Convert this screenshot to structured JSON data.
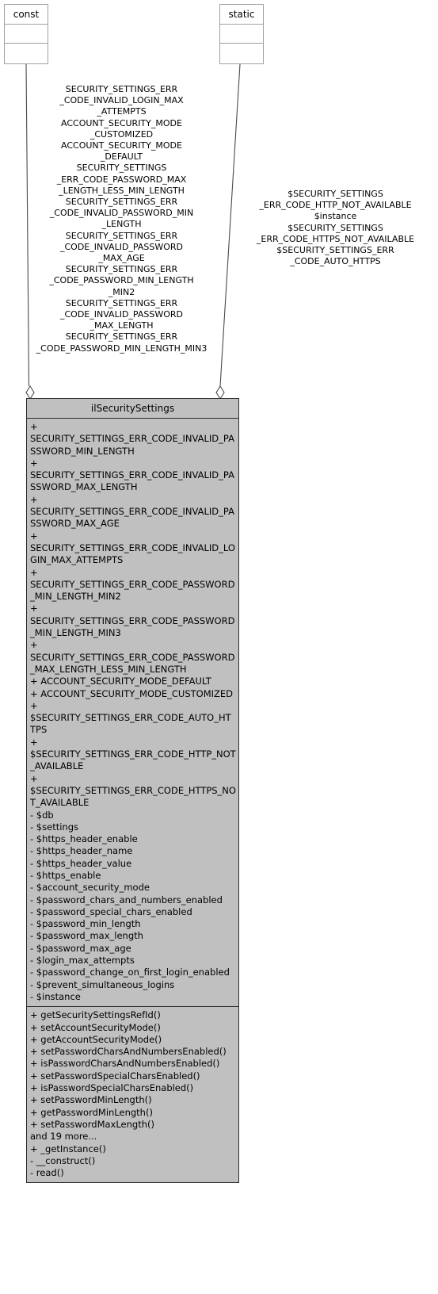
{
  "diagram": {
    "title": "ilSecuritySettings class collaboration diagram",
    "background_color": "#ffffff",
    "class_fill_color": "#c0c0c0",
    "class_border_color": "#2b2b2b",
    "stub_border_color": "#a0a0a0",
    "connector_color": "#4a4a4a"
  },
  "stub_const": {
    "label": "const"
  },
  "stub_static": {
    "label": "static"
  },
  "edges": {
    "const_edge_label": "SECURITY_SETTINGS_ERR\n_CODE_INVALID_LOGIN_MAX\n_ATTEMPTS\nACCOUNT_SECURITY_MODE\n_CUSTOMIZED\nACCOUNT_SECURITY_MODE\n_DEFAULT\nSECURITY_SETTINGS\n_ERR_CODE_PASSWORD_MAX\n_LENGTH_LESS_MIN_LENGTH\nSECURITY_SETTINGS_ERR\n_CODE_INVALID_PASSWORD_MIN\n_LENGTH\nSECURITY_SETTINGS_ERR\n_CODE_INVALID_PASSWORD\n_MAX_AGE\nSECURITY_SETTINGS_ERR\n_CODE_PASSWORD_MIN_LENGTH\n_MIN2\nSECURITY_SETTINGS_ERR\n_CODE_INVALID_PASSWORD\n_MAX_LENGTH\nSECURITY_SETTINGS_ERR\n_CODE_PASSWORD_MIN_LENGTH_MIN3",
    "static_edge_label": "$SECURITY_SETTINGS\n_ERR_CODE_HTTP_NOT_AVAILABLE\n$instance\n$SECURITY_SETTINGS\n_ERR_CODE_HTTPS_NOT_AVAILABLE\n$SECURITY_SETTINGS_ERR\n_CODE_AUTO_HTTPS"
  },
  "class_box": {
    "name": "ilSecuritySettings",
    "attributes": [
      "+ SECURITY_SETTINGS_ERR_CODE_INVALID_PASSWORD_MIN_LENGTH",
      "+ SECURITY_SETTINGS_ERR_CODE_INVALID_PASSWORD_MAX_LENGTH",
      "+ SECURITY_SETTINGS_ERR_CODE_INVALID_PASSWORD_MAX_AGE",
      "+ SECURITY_SETTINGS_ERR_CODE_INVALID_LOGIN_MAX_ATTEMPTS",
      "+ SECURITY_SETTINGS_ERR_CODE_PASSWORD_MIN_LENGTH_MIN2",
      "+ SECURITY_SETTINGS_ERR_CODE_PASSWORD_MIN_LENGTH_MIN3",
      "+ SECURITY_SETTINGS_ERR_CODE_PASSWORD_MAX_LENGTH_LESS_MIN_LENGTH",
      "+ ACCOUNT_SECURITY_MODE_DEFAULT",
      "+ ACCOUNT_SECURITY_MODE_CUSTOMIZED",
      "+ $SECURITY_SETTINGS_ERR_CODE_AUTO_HTTPS",
      "+ $SECURITY_SETTINGS_ERR_CODE_HTTP_NOT_AVAILABLE",
      "+ $SECURITY_SETTINGS_ERR_CODE_HTTPS_NOT_AVAILABLE",
      "- $db",
      "- $settings",
      "- $https_header_enable",
      "- $https_header_name",
      "- $https_header_value",
      "- $https_enable",
      "- $account_security_mode",
      "- $password_chars_and_numbers_enabled",
      "- $password_special_chars_enabled",
      "- $password_min_length",
      "- $password_max_length",
      "- $password_max_age",
      "- $login_max_attempts",
      "- $password_change_on_first_login_enabled",
      "- $prevent_simultaneous_logins",
      "- $instance"
    ],
    "methods": [
      "+ getSecuritySettingsRefId()",
      "+ setAccountSecurityMode()",
      "+ getAccountSecurityMode()",
      "+ setPasswordCharsAndNumbersEnabled()",
      "+ isPasswordCharsAndNumbersEnabled()",
      "+ setPasswordSpecialCharsEnabled()",
      "+ isPasswordSpecialCharsEnabled()",
      "+ setPasswordMinLength()",
      "+ getPasswordMinLength()",
      "+ setPasswordMaxLength()",
      "and 19 more...",
      "+ _getInstance()",
      "- __construct()",
      "- read()"
    ]
  }
}
